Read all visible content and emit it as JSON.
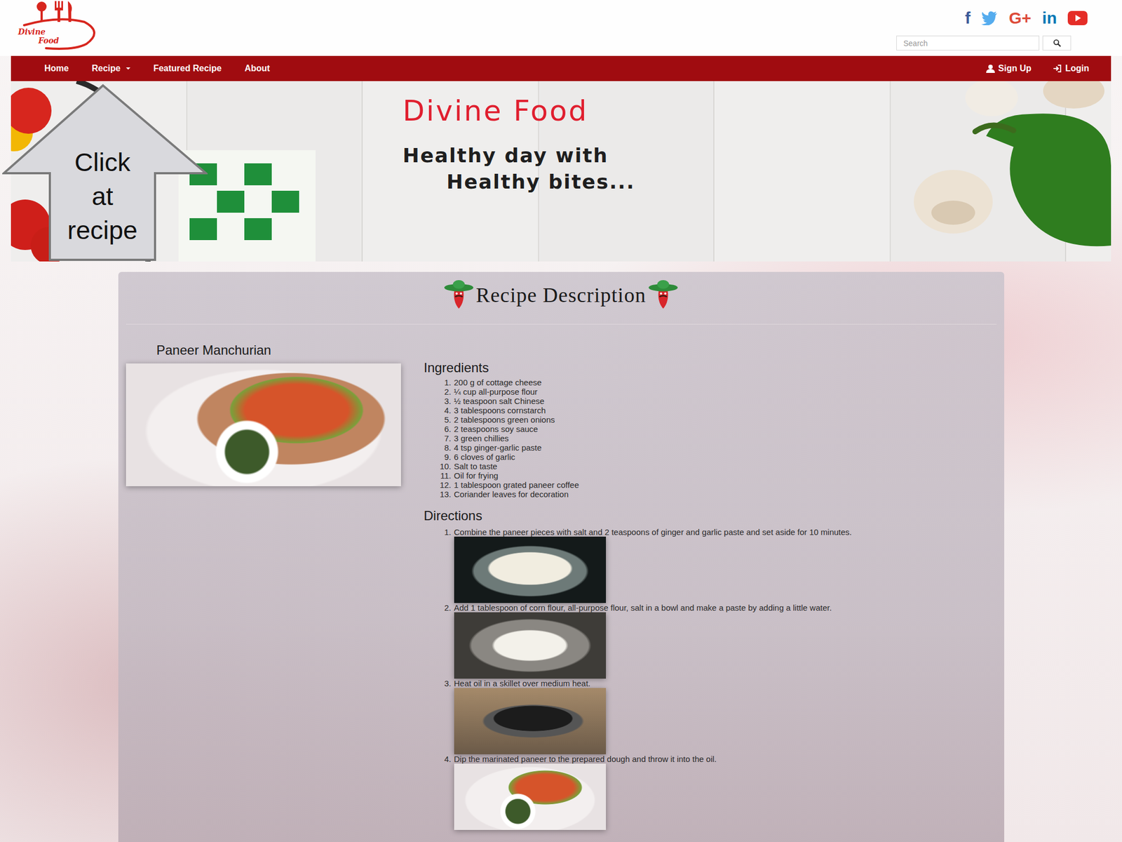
{
  "logo": {
    "lines": [
      "Divine",
      "Food"
    ]
  },
  "social": [
    {
      "kind": "text",
      "glyph": "f",
      "color": "#3b5998"
    },
    {
      "kind": "bird",
      "color": "#55acee"
    },
    {
      "kind": "text",
      "glyph": "G+",
      "color": "#dd4b39"
    },
    {
      "kind": "text",
      "glyph": "in",
      "color": "#0077b5"
    },
    {
      "kind": "play",
      "color": "#e52d27"
    }
  ],
  "search": {
    "placeholder": "Search"
  },
  "nav": {
    "left": [
      {
        "label": "Home",
        "dropdown": false
      },
      {
        "label": "Recipe",
        "dropdown": true
      },
      {
        "label": "Featured Recipe",
        "dropdown": false
      },
      {
        "label": "About",
        "dropdown": false
      }
    ],
    "right": [
      {
        "label": "Sign Up",
        "kind": "user"
      },
      {
        "label": "Login",
        "kind": "login"
      }
    ]
  },
  "banner": {
    "title": "Divine Food",
    "tagline": [
      "Healthy day with",
      "Healthy bites..."
    ]
  },
  "callout": {
    "lines": [
      "Click",
      "at",
      "recipe"
    ]
  },
  "panel": {
    "title": "Recipe Description",
    "recipe": {
      "name": "Paneer Manchurian",
      "ingredients_heading": "Ingredients",
      "ingredients": [
        {
          "n": "1.",
          "text": "200 g of cottage cheese"
        },
        {
          "n": "2.",
          "text": "¼ cup all-purpose flour"
        },
        {
          "n": "3.",
          "text": "½ teaspoon salt Chinese"
        },
        {
          "n": "4.",
          "text": "3 tablespoons cornstarch"
        },
        {
          "n": "5.",
          "text": "2 tablespoons green onions"
        },
        {
          "n": "6.",
          "text": "2 teaspoons soy sauce"
        },
        {
          "n": "7.",
          "text": "3 green chillies"
        },
        {
          "n": "8.",
          "text": "4 tsp ginger-garlic paste"
        },
        {
          "n": "9.",
          "text": "6 cloves of garlic"
        },
        {
          "n": "10.",
          "text": "Salt to taste"
        },
        {
          "n": "11.",
          "text": "Oil for frying"
        },
        {
          "n": "12.",
          "text": "1 tablespoon grated paneer coffee"
        },
        {
          "n": "13.",
          "text": "Coriander leaves for decoration"
        }
      ],
      "directions_heading": "Directions",
      "directions": [
        {
          "n": "1.",
          "text": "Combine the paneer pieces with salt and 2 teaspoons of ginger and garlic paste and set aside for 10 minutes."
        },
        {
          "n": "2.",
          "text": "Add 1 tablespoon of corn flour, all-purpose flour, salt in a bowl and make a paste by adding a little water."
        },
        {
          "n": "3.",
          "text": "Heat oil in a skillet over medium heat."
        },
        {
          "n": "4.",
          "text": "Dip the marinated paneer to the prepared dough and throw it into the oil."
        }
      ]
    }
  }
}
